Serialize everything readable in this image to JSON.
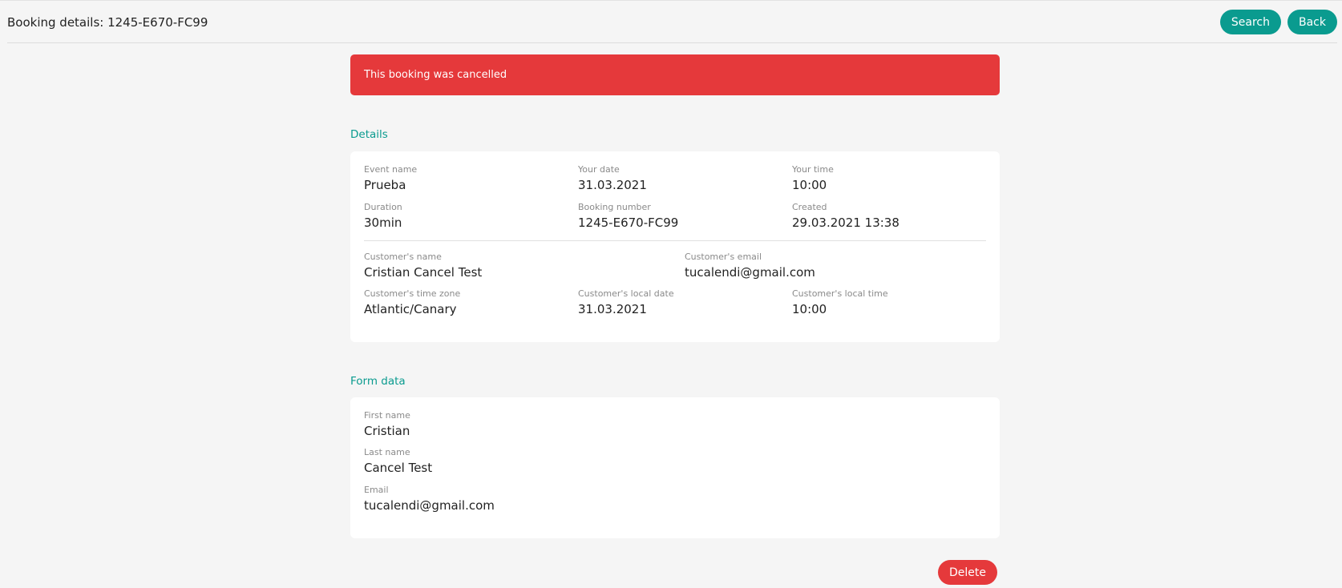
{
  "header": {
    "title": "Booking details: 1245-E670-FC99",
    "search_label": "Search",
    "back_label": "Back"
  },
  "alert": {
    "text": "This booking was cancelled"
  },
  "details": {
    "section_title": "Details",
    "event_name": {
      "label": "Event name",
      "value": "Prueba"
    },
    "your_date": {
      "label": "Your date",
      "value": "31.03.2021"
    },
    "your_time": {
      "label": "Your time",
      "value": "10:00"
    },
    "duration": {
      "label": "Duration",
      "value": "30min"
    },
    "booking_number": {
      "label": "Booking number",
      "value": "1245-E670-FC99"
    },
    "created": {
      "label": "Created",
      "value": "29.03.2021 13:38"
    },
    "customer_name": {
      "label": "Customer's name",
      "value": "Cristian Cancel Test"
    },
    "customer_email": {
      "label": "Customer's email",
      "value": "tucalendi@gmail.com"
    },
    "customer_time_zone": {
      "label": "Customer's time zone",
      "value": "Atlantic/Canary"
    },
    "customer_local_date": {
      "label": "Customer's local date",
      "value": "31.03.2021"
    },
    "customer_local_time": {
      "label": "Customer's local time",
      "value": "10:00"
    }
  },
  "form_data": {
    "section_title": "Form data",
    "first_name": {
      "label": "First name",
      "value": "Cristian"
    },
    "last_name": {
      "label": "Last name",
      "value": "Cancel Test"
    },
    "email": {
      "label": "Email",
      "value": "tucalendi@gmail.com"
    }
  },
  "actions": {
    "delete_label": "Delete"
  },
  "colors": {
    "accent": "#0a9b8f",
    "danger": "#e5393b",
    "background": "#f5f5f5"
  }
}
